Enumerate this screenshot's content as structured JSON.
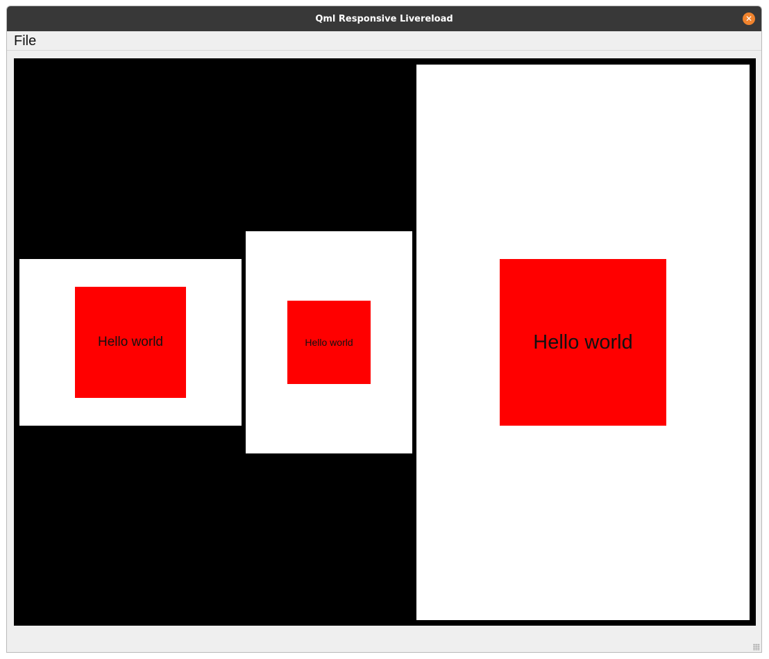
{
  "window": {
    "title": "Qml Responsive Livereload",
    "close_icon": "close-icon"
  },
  "menubar": {
    "items": [
      {
        "label": "File"
      }
    ]
  },
  "panels": [
    {
      "label": "Hello world"
    },
    {
      "label": "Hello world"
    },
    {
      "label": "Hello world"
    }
  ],
  "colors": {
    "titlebar": "#383838",
    "close": "#f0832d",
    "canvas": "#000000",
    "panel": "#ffffff",
    "box": "#ff0000"
  }
}
